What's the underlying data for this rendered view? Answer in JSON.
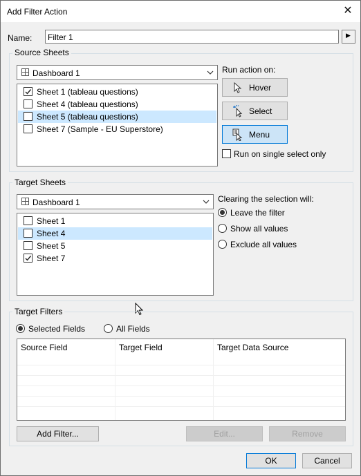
{
  "window": {
    "title": "Add Filter Action",
    "close_glyph": "✕"
  },
  "name": {
    "label": "Name:",
    "value": "Filter 1",
    "menu_glyph": "▶"
  },
  "source": {
    "group_label": "Source Sheets",
    "dashboard": "Dashboard 1",
    "sheets": [
      {
        "label": "Sheet 1 (tableau questions)",
        "checked": true,
        "selected": false
      },
      {
        "label": "Sheet 4 (tableau questions)",
        "checked": false,
        "selected": false
      },
      {
        "label": "Sheet 5 (tableau questions)",
        "checked": false,
        "selected": true
      },
      {
        "label": "Sheet 7 (Sample - EU Superstore)",
        "checked": false,
        "selected": false
      }
    ],
    "run_action_label": "Run action on:",
    "run_buttons": [
      {
        "label": "Hover",
        "icon": "pointer-icon",
        "active": false
      },
      {
        "label": "Select",
        "icon": "select-sparkle-icon",
        "active": false
      },
      {
        "label": "Menu",
        "icon": "menu-icon",
        "active": true
      }
    ],
    "single_select_label": "Run on single select only",
    "single_select_checked": false
  },
  "target": {
    "group_label": "Target Sheets",
    "dashboard": "Dashboard 1",
    "sheets": [
      {
        "label": "Sheet 1",
        "checked": false,
        "selected": false
      },
      {
        "label": "Sheet 4",
        "checked": false,
        "selected": true
      },
      {
        "label": "Sheet 5",
        "checked": false,
        "selected": false
      },
      {
        "label": "Sheet 7",
        "checked": true,
        "selected": false
      }
    ],
    "clearing_label": "Clearing the selection will:",
    "clearing_options": [
      {
        "label": "Leave the filter",
        "selected": true
      },
      {
        "label": "Show all values",
        "selected": false
      },
      {
        "label": "Exclude all values",
        "selected": false
      }
    ]
  },
  "filters": {
    "group_label": "Target Filters",
    "scope_options": [
      {
        "label": "Selected Fields",
        "selected": true
      },
      {
        "label": "All Fields",
        "selected": false
      }
    ],
    "columns": [
      "Source Field",
      "Target Field",
      "Target Data Source"
    ],
    "add_label": "Add Filter...",
    "edit_label": "Edit...",
    "remove_label": "Remove"
  },
  "footer": {
    "ok_label": "OK",
    "cancel_label": "Cancel"
  }
}
